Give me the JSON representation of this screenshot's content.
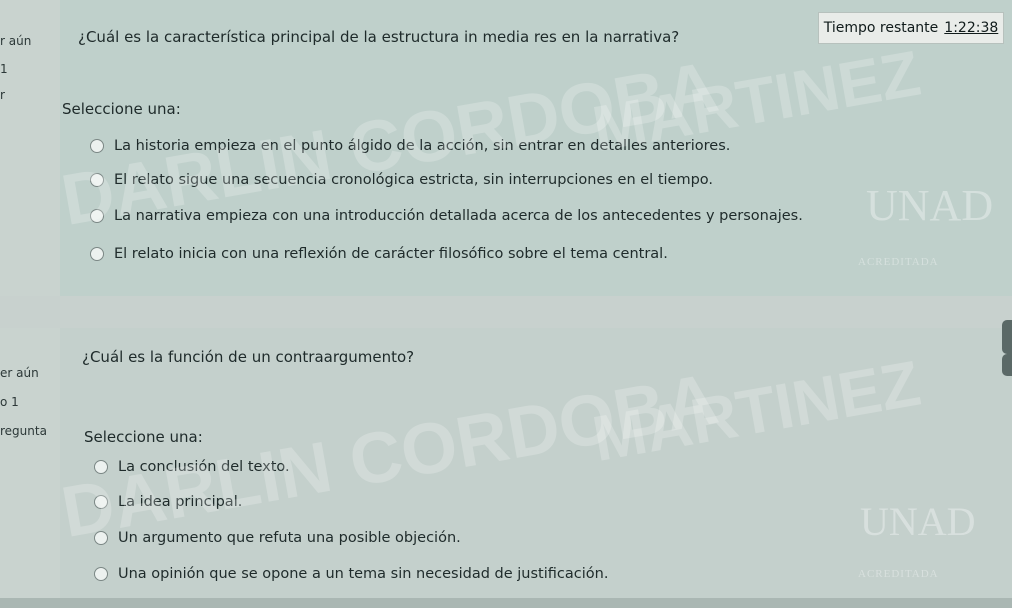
{
  "sidebar": {
    "q1_status": "r aún",
    "q1_number": "1",
    "q1_extra": "r",
    "q2_status": "er aún",
    "q2_number": "o 1",
    "q2_flag": "regunta"
  },
  "timer": {
    "label": "Tiempo restante",
    "value": "1:22:38"
  },
  "question1": {
    "text": "¿Cuál es la característica principal de la estructura in media res en la narrativa?",
    "select_label": "Seleccione una:",
    "options": [
      "La historia empieza en el punto álgido de la acción, sin entrar en detalles anteriores.",
      "El relato sigue una secuencia cronológica estricta, sin interrupciones en el tiempo.",
      "La narrativa empieza con una introducción detallada acerca de los antecedentes y personajes.",
      "El relato inicia con una reflexión de carácter filosófico sobre el tema central."
    ]
  },
  "question2": {
    "text": "¿Cuál es la función de un contraargumento?",
    "select_label": "Seleccione una:",
    "options": [
      "La conclusión del texto.",
      "La idea principal.",
      "Un argumento que refuta una posible objeción.",
      "Una opinión que se opone a un tema sin necesidad de justificación."
    ]
  },
  "watermark": {
    "line1": "MARTINEZ",
    "line2": "DARLIN CORDOBA"
  },
  "logo": {
    "mark": "UNAD",
    "accreditation": "ACREDITADA"
  }
}
